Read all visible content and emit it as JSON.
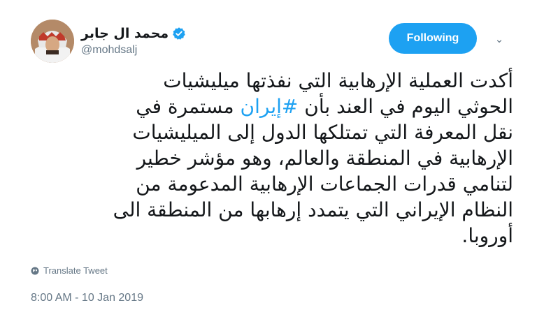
{
  "tweet": {
    "author": {
      "display_name": "محمد ال جابر",
      "handle": "@mohdsalj",
      "verified_icon": "verified-badge-icon",
      "avatar_icon": "avatar"
    },
    "follow_button_label": "Following",
    "more_icon": "chevron-down-icon",
    "text": {
      "line1": "أكدت العملية الإرهابية التي نفذتها ميليشيات",
      "line2_pre": "الحوثي اليوم في العند بأن ",
      "hashtag": "#إيران",
      "line2_post": " مستمرة في",
      "line3": "نقل المعرفة التي تمتلكها الدول إلى  الميليشيات",
      "line4": "الإرهابية في المنطقة والعالم، وهو مؤشر خطير",
      "line5": "لتنامي قدرات الجماعات الإرهابية المدعومة من",
      "line6": "النظام الإيراني التي يتمدد إرهابها من المنطقة الى",
      "line7": "أوروبا."
    },
    "translate_label": "Translate Tweet",
    "translate_icon": "globe-icon",
    "timestamp": "8:00 AM - 10 Jan 2019"
  },
  "colors": {
    "accent": "#1da1f2",
    "text": "#14171a",
    "secondary": "#657786",
    "background": "#ffffff"
  }
}
